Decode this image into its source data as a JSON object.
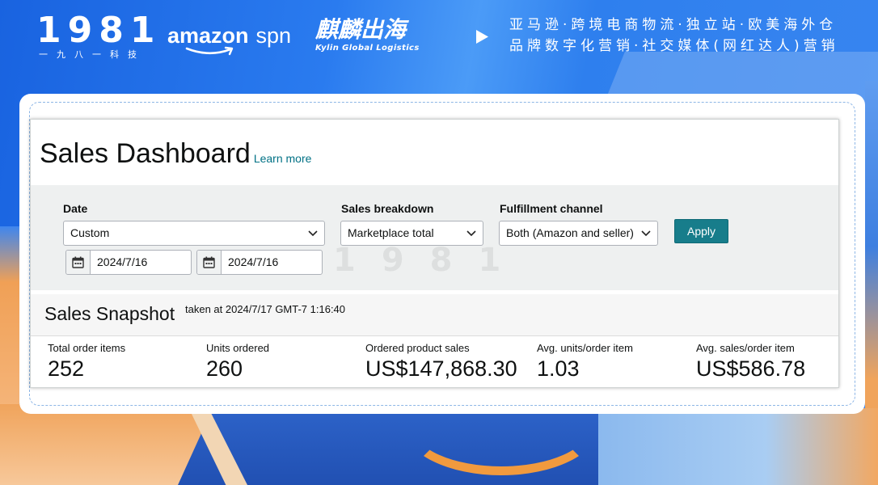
{
  "banner": {
    "logo_1981": "1981",
    "logo_1981_sub": "一九八一科技",
    "amazon_logo": "amazon",
    "amazon_logo_suffix": "spn",
    "kylin_logo": "麒麟出海",
    "kylin_logo_sub": "Kylin Global Logistics",
    "tagline_line1": "亚马逊·跨境电商物流·独立站·欧美海外仓",
    "tagline_line2": "品牌数字化营销·社交媒体(网红达人)营销",
    "play_icon": "play-icon"
  },
  "watermark": "1981",
  "dashboard": {
    "title": "Sales Dashboard",
    "learn_more": "Learn more",
    "filters": {
      "date": {
        "label": "Date",
        "value": "Custom",
        "start_date": "2024/7/16",
        "end_date": "2024/7/16"
      },
      "sales_breakdown": {
        "label": "Sales breakdown",
        "value": "Marketplace total"
      },
      "fulfillment_channel": {
        "label": "Fulfillment channel",
        "value": "Both (Amazon and seller)"
      },
      "apply_label": "Apply"
    },
    "snapshot": {
      "title": "Sales Snapshot",
      "taken_at": "taken at 2024/7/17 GMT-7 1:16:40",
      "metrics": [
        {
          "label": "Total order items",
          "value": "252"
        },
        {
          "label": "Units ordered",
          "value": "260"
        },
        {
          "label": "Ordered product sales",
          "value": "US$147,868.30"
        },
        {
          "label": "Avg. units/order item",
          "value": "1.03"
        },
        {
          "label": "Avg. sales/order item",
          "value": "US$586.78"
        }
      ]
    }
  },
  "icons": {
    "select_arrow": "chevron-down-icon",
    "date_picker": "calendar-icon",
    "banner_arrow": "play-icon"
  },
  "colors": {
    "banner_blue": "#2a7bef",
    "accent_button": "#177d8b",
    "link": "#007185",
    "filter_background": "#eef0f0",
    "text": "#0f1111"
  }
}
